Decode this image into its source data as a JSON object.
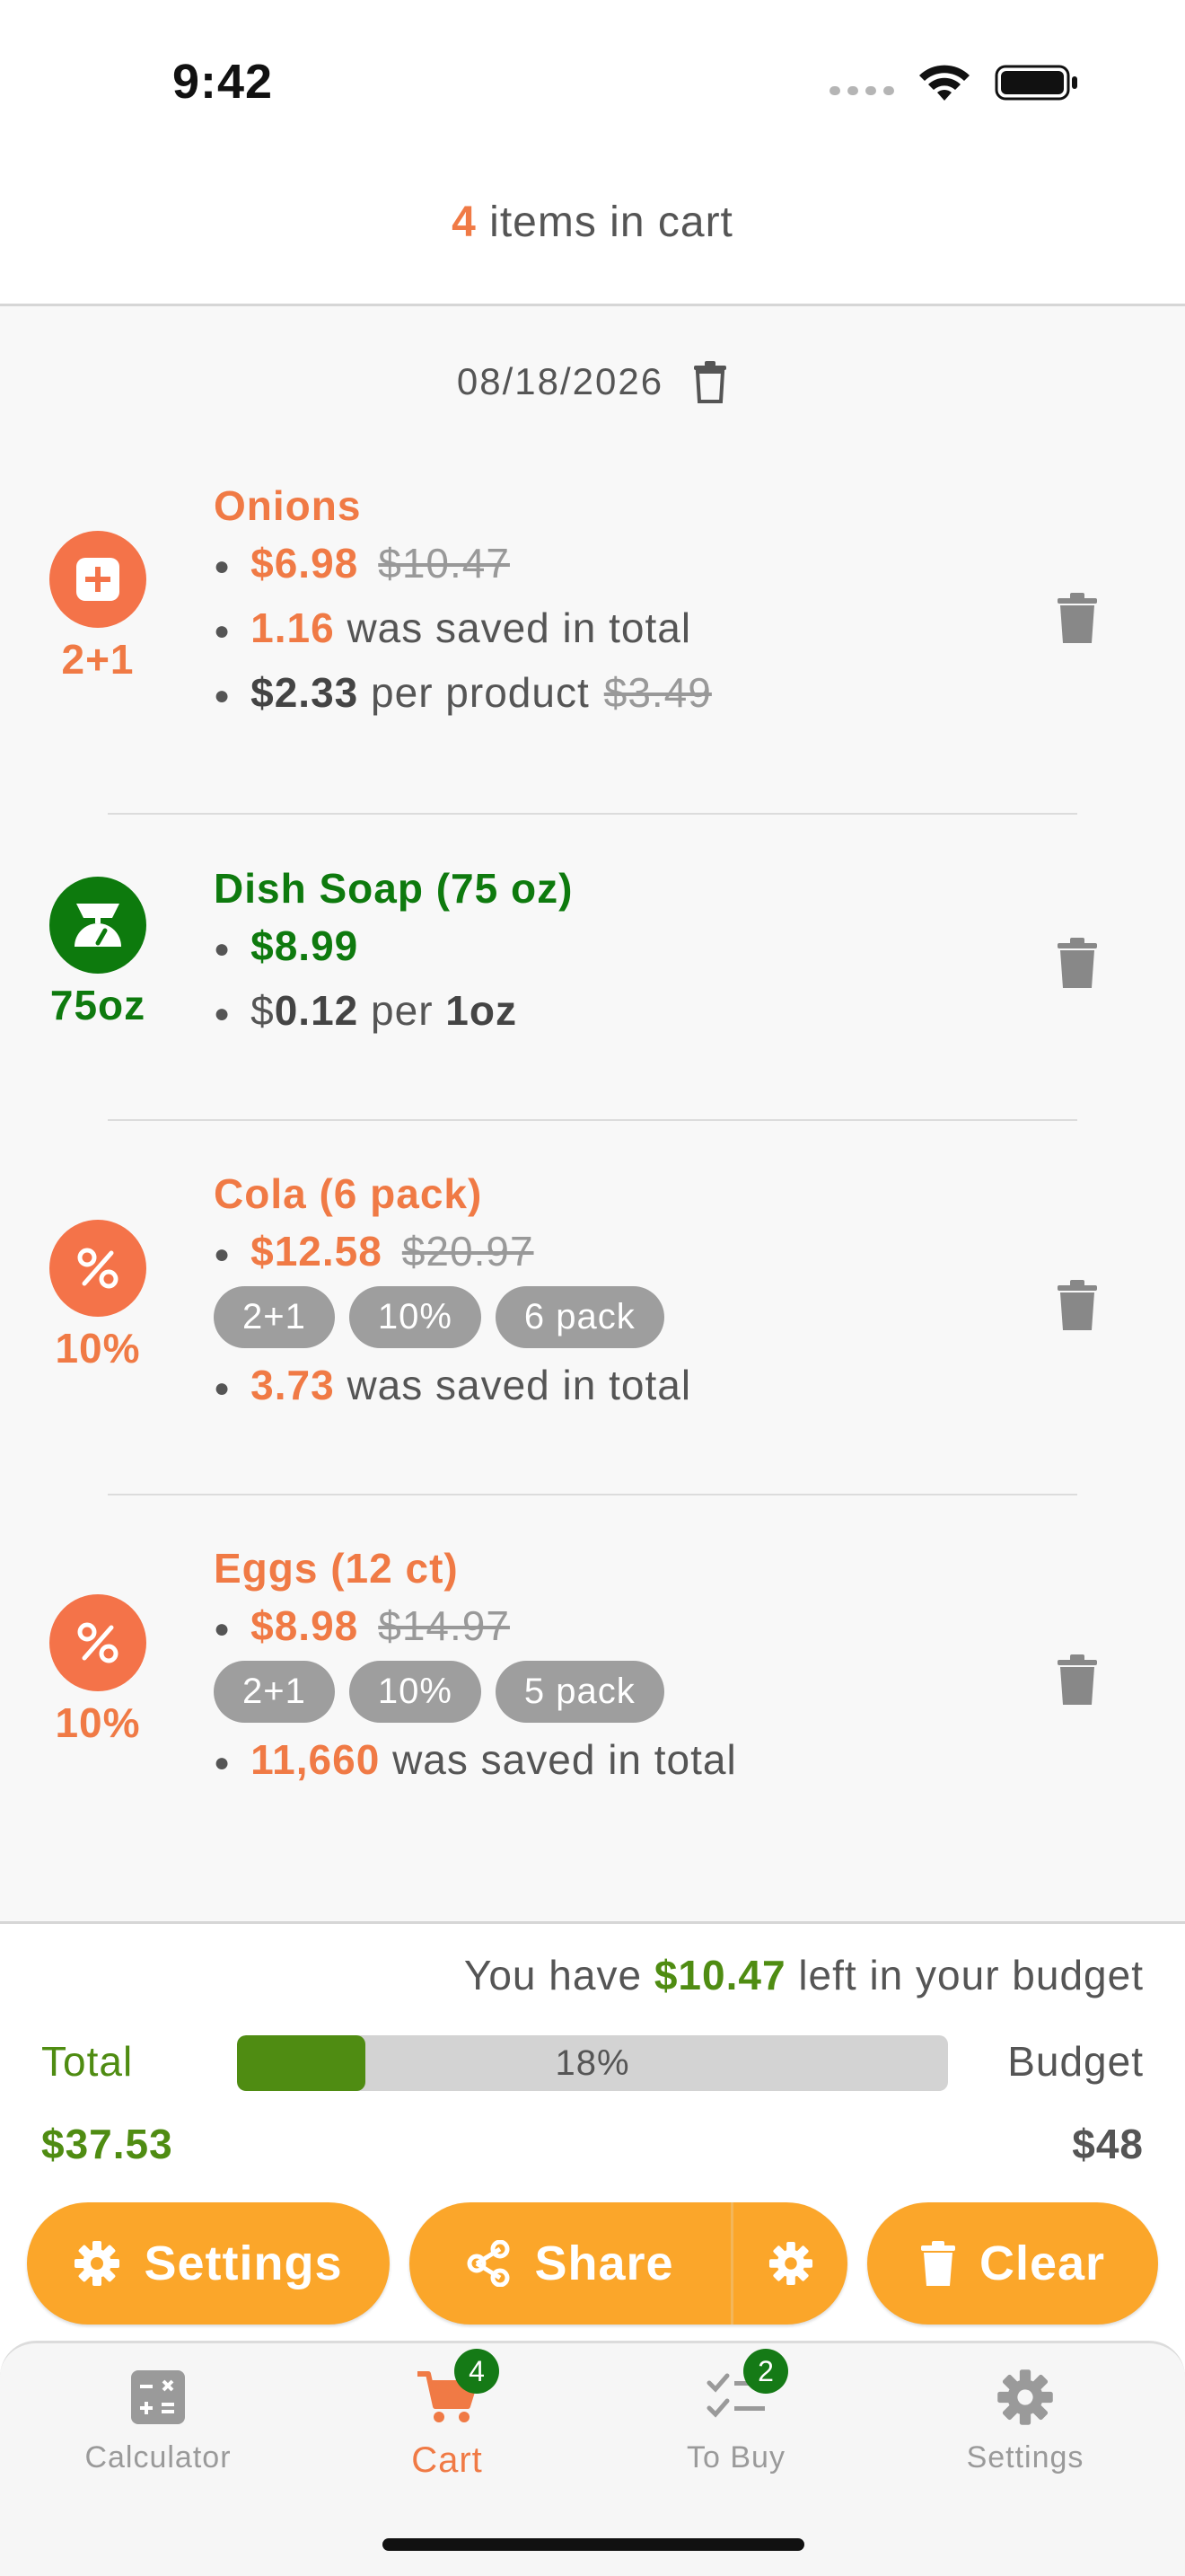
{
  "status_bar": {
    "time": "9:42"
  },
  "header": {
    "count": "4",
    "text": "items in cart"
  },
  "cart": {
    "date": "08/18/2026",
    "items": [
      {
        "badge_label": "2+1",
        "name": "Onions",
        "price": "$6.98",
        "original_price": "$10.47",
        "saved_amount": "1.16",
        "saved_text": "was saved in total",
        "per_product_price": "$2.33",
        "per_product_text": "per product",
        "per_product_original": "$3.49"
      },
      {
        "badge_label": "75oz",
        "name": "Dish Soap (75 oz)",
        "price": "$8.99",
        "unit_price_prefix": "$",
        "unit_price": "0.12",
        "unit_per": "per",
        "unit": "1oz"
      },
      {
        "badge_label": "10%",
        "name": "Cola (6 pack)",
        "price": "$12.58",
        "original_price": "$20.97",
        "chips": [
          "2+1",
          "10%",
          "6 pack"
        ],
        "saved_amount": "3.73",
        "saved_text": "was saved in total"
      },
      {
        "badge_label": "10%",
        "name": "Eggs (12 ct)",
        "price": "$8.98",
        "original_price": "$14.97",
        "chips": [
          "2+1",
          "10%",
          "5 pack"
        ],
        "saved_amount": "11,660",
        "saved_text": "was saved in total"
      }
    ]
  },
  "budget": {
    "msg_prefix": "You have",
    "remaining": "$10.47",
    "msg_suffix": "left in your budget",
    "total_label": "Total",
    "total_value": "$37.53",
    "budget_label": "Budget",
    "budget_value": "$48",
    "progress_text": "18%",
    "progress_fraction": 0.18
  },
  "actions": {
    "settings_label": "Settings",
    "share_label": "Share",
    "clear_label": "Clear"
  },
  "tabbar": {
    "calculator": "Calculator",
    "cart": "Cart",
    "cart_badge": "4",
    "to_buy": "To Buy",
    "to_buy_badge": "2",
    "settings": "Settings"
  },
  "colors": {
    "accent_orange": "#f07a45",
    "accent_green": "#0e7a0e",
    "button_orange": "#fba62a",
    "budget_green": "#4f8c12"
  }
}
